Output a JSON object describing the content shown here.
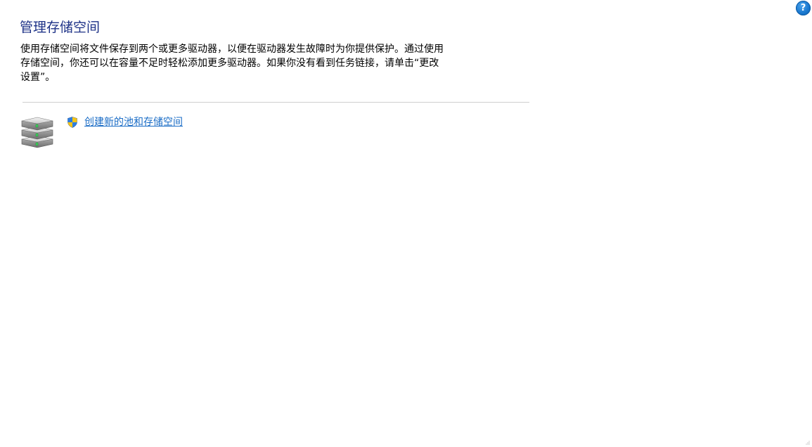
{
  "header": {
    "help_label": "?",
    "title": "管理存储空间"
  },
  "main": {
    "description": "使用存储空间将文件保存到两个或更多驱动器，以便在驱动器发生故障时为你提供保护。通过使用存储空间，你还可以在容量不足时轻松添加更多驱动器。如果你没有看到任务链接，请单击“更改设置”。",
    "tasks": [
      {
        "label": "创建新的池和存储空间",
        "icon": "uac-shield-icon"
      }
    ],
    "section_icon": "storage-drives-icon"
  },
  "colors": {
    "title": "#1e3287",
    "link": "#1a6cc6",
    "help_button": "#1a78cf",
    "divider": "#cfcfcf"
  }
}
